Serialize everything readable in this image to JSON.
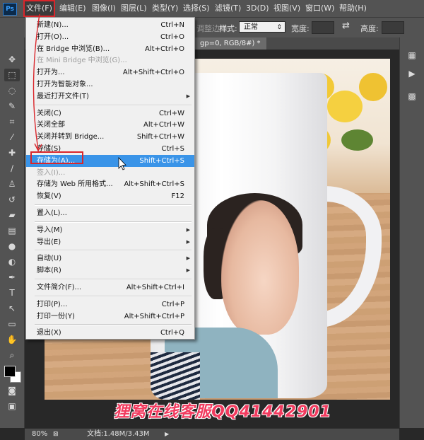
{
  "menubar": {
    "logo": "Ps",
    "items": [
      "文件(F)",
      "编辑(E)",
      "图像(I)",
      "图层(L)",
      "类型(Y)",
      "选择(S)",
      "滤镜(T)",
      "3D(D)",
      "视图(V)",
      "窗口(W)",
      "帮助(H)"
    ]
  },
  "options": {
    "style_label": "样式:",
    "style_value": "正常",
    "width_label": "宽度:",
    "height_label": "高度:",
    "edge_label": "调整边缘..."
  },
  "doc_tab": "gp=0, RGB/8#) *",
  "file_menu": [
    {
      "type": "item",
      "label": "新建(N)...",
      "shortcut": "Ctrl+N"
    },
    {
      "type": "item",
      "label": "打开(O)...",
      "shortcut": "Ctrl+O"
    },
    {
      "type": "item",
      "label": "在 Bridge 中浏览(B)...",
      "shortcut": "Alt+Ctrl+O"
    },
    {
      "type": "item",
      "label": "在 Mini Bridge 中浏览(G)...",
      "shortcut": "",
      "disabled": true
    },
    {
      "type": "item",
      "label": "打开为...",
      "shortcut": "Alt+Shift+Ctrl+O"
    },
    {
      "type": "item",
      "label": "打开为智能对象...",
      "shortcut": ""
    },
    {
      "type": "item",
      "label": "最近打开文件(T)",
      "shortcut": "",
      "submenu": true
    },
    {
      "type": "sep"
    },
    {
      "type": "item",
      "label": "关闭(C)",
      "shortcut": "Ctrl+W"
    },
    {
      "type": "item",
      "label": "关闭全部",
      "shortcut": "Alt+Ctrl+W"
    },
    {
      "type": "item",
      "label": "关闭并转到 Bridge...",
      "shortcut": "Shift+Ctrl+W"
    },
    {
      "type": "item",
      "label": "存储(S)",
      "shortcut": "Ctrl+S"
    },
    {
      "type": "item",
      "label": "存储为(A)...",
      "shortcut": "Shift+Ctrl+S",
      "highlighted": true
    },
    {
      "type": "item",
      "label": "签入(I)...",
      "shortcut": "",
      "disabled": true
    },
    {
      "type": "item",
      "label": "存储为 Web 所用格式...",
      "shortcut": "Alt+Shift+Ctrl+S"
    },
    {
      "type": "item",
      "label": "恢复(V)",
      "shortcut": "F12"
    },
    {
      "type": "sep"
    },
    {
      "type": "item",
      "label": "置入(L)...",
      "shortcut": ""
    },
    {
      "type": "sep"
    },
    {
      "type": "item",
      "label": "导入(M)",
      "shortcut": "",
      "submenu": true
    },
    {
      "type": "item",
      "label": "导出(E)",
      "shortcut": "",
      "submenu": true
    },
    {
      "type": "sep"
    },
    {
      "type": "item",
      "label": "自动(U)",
      "shortcut": "",
      "submenu": true
    },
    {
      "type": "item",
      "label": "脚本(R)",
      "shortcut": "",
      "submenu": true
    },
    {
      "type": "sep"
    },
    {
      "type": "item",
      "label": "文件简介(F)...",
      "shortcut": "Alt+Shift+Ctrl+I"
    },
    {
      "type": "sep"
    },
    {
      "type": "item",
      "label": "打印(P)...",
      "shortcut": "Ctrl+P"
    },
    {
      "type": "item",
      "label": "打印一份(Y)",
      "shortcut": "Alt+Shift+Ctrl+P"
    },
    {
      "type": "sep"
    },
    {
      "type": "item",
      "label": "退出(X)",
      "shortcut": "Ctrl+Q"
    }
  ],
  "status": {
    "zoom": "80%",
    "doc_info": "文档:1.48M/3.43M"
  },
  "watermark": "狸窝在线客服QQ41442901",
  "colors": {
    "annotation_red": "#d9262b",
    "menu_highlight": "#3a94e8",
    "watermark": "#f23b5f"
  }
}
